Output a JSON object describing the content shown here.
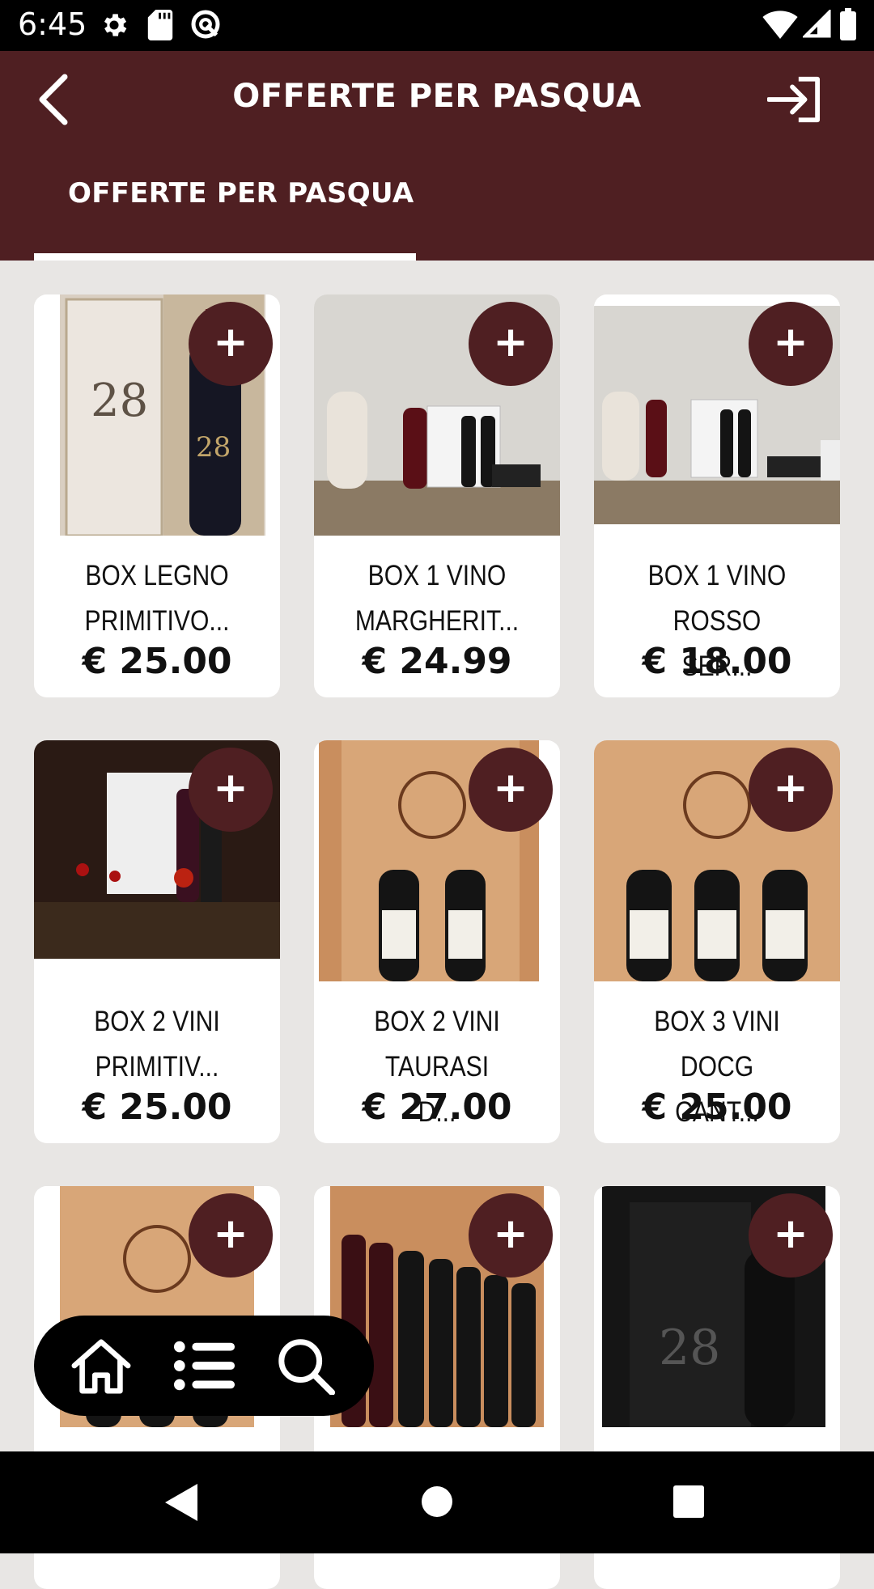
{
  "status_bar": {
    "time": "6:45",
    "icons": [
      "settings-icon",
      "sd-card-icon",
      "sync-icon",
      "wifi-icon",
      "signal-icon",
      "battery-icon"
    ]
  },
  "app_bar": {
    "title": "OFFERTE PER PASQUA",
    "back_icon": "chevron-left-icon",
    "login_icon": "login-icon"
  },
  "tabs": [
    {
      "label": "OFFERTE PER PASQUA",
      "selected": true
    }
  ],
  "products": [
    {
      "name_line1": "BOX LEGNO",
      "name_line2": "PRIMITIVO...",
      "price": "€ 25.00"
    },
    {
      "name_line1": "BOX 1 VINO",
      "name_line2": "MARGHERIT...",
      "price": "€ 24.99"
    },
    {
      "name_line1": "BOX 1 VINO ROSSO",
      "name_line2": "SER...",
      "price": "€ 18.00"
    },
    {
      "name_line1": "BOX 2 VINI",
      "name_line2": "PRIMITIV...",
      "price": "€ 25.00"
    },
    {
      "name_line1": "BOX 2 VINI TAURASI",
      "name_line2": "D...",
      "price": "€ 27.00"
    },
    {
      "name_line1": "BOX 3 VINI DOCG",
      "name_line2": "CANT...",
      "price": "€ 25.00"
    },
    {
      "name_line1": "",
      "name_line2": "",
      "price": ""
    },
    {
      "name_line1": "",
      "name_line2": "",
      "price": ""
    },
    {
      "name_line1": "",
      "name_line2": "",
      "price": ""
    }
  ],
  "add_button_label": "+",
  "floating_nav": [
    "home-icon",
    "list-icon",
    "search-icon"
  ],
  "system_nav": [
    "back-triangle-icon",
    "home-circle-icon",
    "recents-square-icon"
  ],
  "colors": {
    "brand": "#4f1f22",
    "background": "#e8e6e4"
  }
}
